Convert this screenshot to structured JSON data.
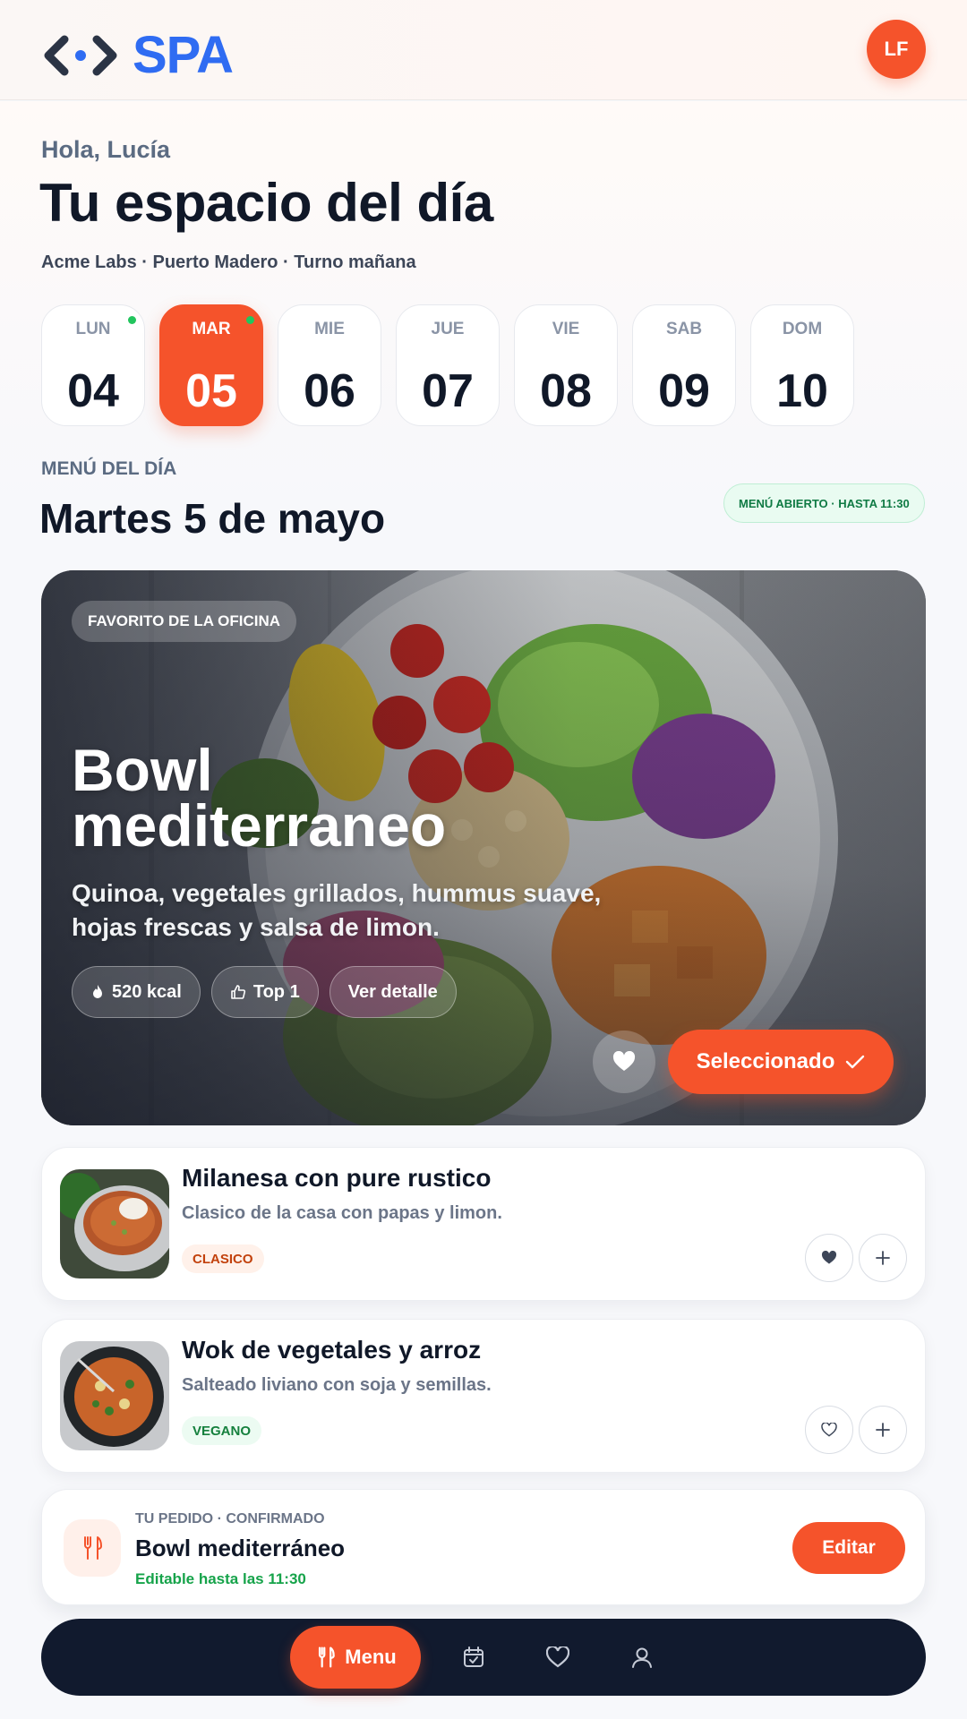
{
  "header": {
    "logo_text": "SPA",
    "avatar_initials": "LF",
    "brand_color": "#2f6cf2",
    "accent_color": "#f5532b"
  },
  "intro": {
    "greeting": "Hola, Lucía",
    "title": "Tu espacio del día",
    "subtitle": "Acme Labs · Puerto Madero · Turno mañana"
  },
  "days": [
    {
      "name": "LUN",
      "num": "04",
      "active": false,
      "dot": true
    },
    {
      "name": "MAR",
      "num": "05",
      "active": true,
      "dot": true
    },
    {
      "name": "MIE",
      "num": "06",
      "active": false,
      "dot": false
    },
    {
      "name": "JUE",
      "num": "07",
      "active": false,
      "dot": false
    },
    {
      "name": "VIE",
      "num": "08",
      "active": false,
      "dot": false
    },
    {
      "name": "SAB",
      "num": "09",
      "active": false,
      "dot": false
    },
    {
      "name": "DOM",
      "num": "10",
      "active": false,
      "dot": false
    }
  ],
  "menu": {
    "label": "MENÚ DEL DÍA",
    "date_title": "Martes 5 de mayo",
    "status_badge": "MENÚ ABIERTO · HASTA 11:30"
  },
  "featured": {
    "tag": "FAVORITO DE LA OFICINA",
    "title": "Bowl mediterraneo",
    "description": "Quinoa, vegetales grillados, hummus suave, hojas frescas y salsa de limon.",
    "chips": [
      {
        "icon": "flame-icon",
        "label": "520 kcal"
      },
      {
        "icon": "thumbs-up-icon",
        "label": "Top 1"
      },
      {
        "icon": "",
        "label": "Ver detalle"
      }
    ],
    "select_label": "Seleccionado"
  },
  "dishes": [
    {
      "title": "Milanesa con pure rustico",
      "description": "Clasico de la casa con papas y limon.",
      "tag": "CLASICO",
      "tag_bg": "#fff1ea",
      "tag_color": "#c2410c",
      "favorited": true
    },
    {
      "title": "Wok de vegetales y arroz",
      "description": "Salteado liviano con soja y semillas.",
      "tag": "VEGANO",
      "tag_bg": "#ecfbf2",
      "tag_color": "#15803d",
      "favorited": false
    }
  ],
  "order": {
    "label": "TU PEDIDO · CONFIRMADO",
    "title": "Bowl mediterráneo",
    "note": "Editable hasta las 11:30",
    "button": "Editar"
  },
  "nav": {
    "active_label": "Menu",
    "items": [
      "utensils-icon",
      "calendar-check-icon",
      "heart-icon",
      "user-icon"
    ]
  }
}
